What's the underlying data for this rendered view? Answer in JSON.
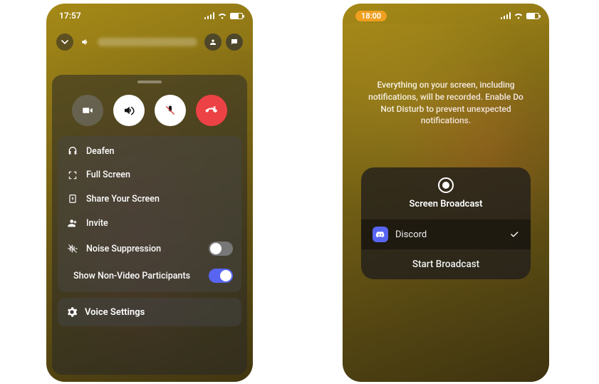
{
  "left": {
    "time": "17:57",
    "controls": {
      "camera": "camera",
      "speaker": "speaker",
      "mute": "mute",
      "hangup": "hangup"
    },
    "options": {
      "deafen": "Deafen",
      "fullscreen": "Full Screen",
      "share": "Share Your Screen",
      "invite": "Invite",
      "noise": "Noise Suppression",
      "shownv": "Show Non-Video Participants"
    },
    "toggles": {
      "noise": false,
      "shownv": true
    },
    "voice_settings": "Voice Settings"
  },
  "right": {
    "time": "18:00",
    "message": "Everything on your screen, including notifications, will be recorded. Enable Do Not Disturb to prevent unexpected notifications.",
    "sheet_title": "Screen Broadcast",
    "app": "Discord",
    "start": "Start Broadcast"
  }
}
